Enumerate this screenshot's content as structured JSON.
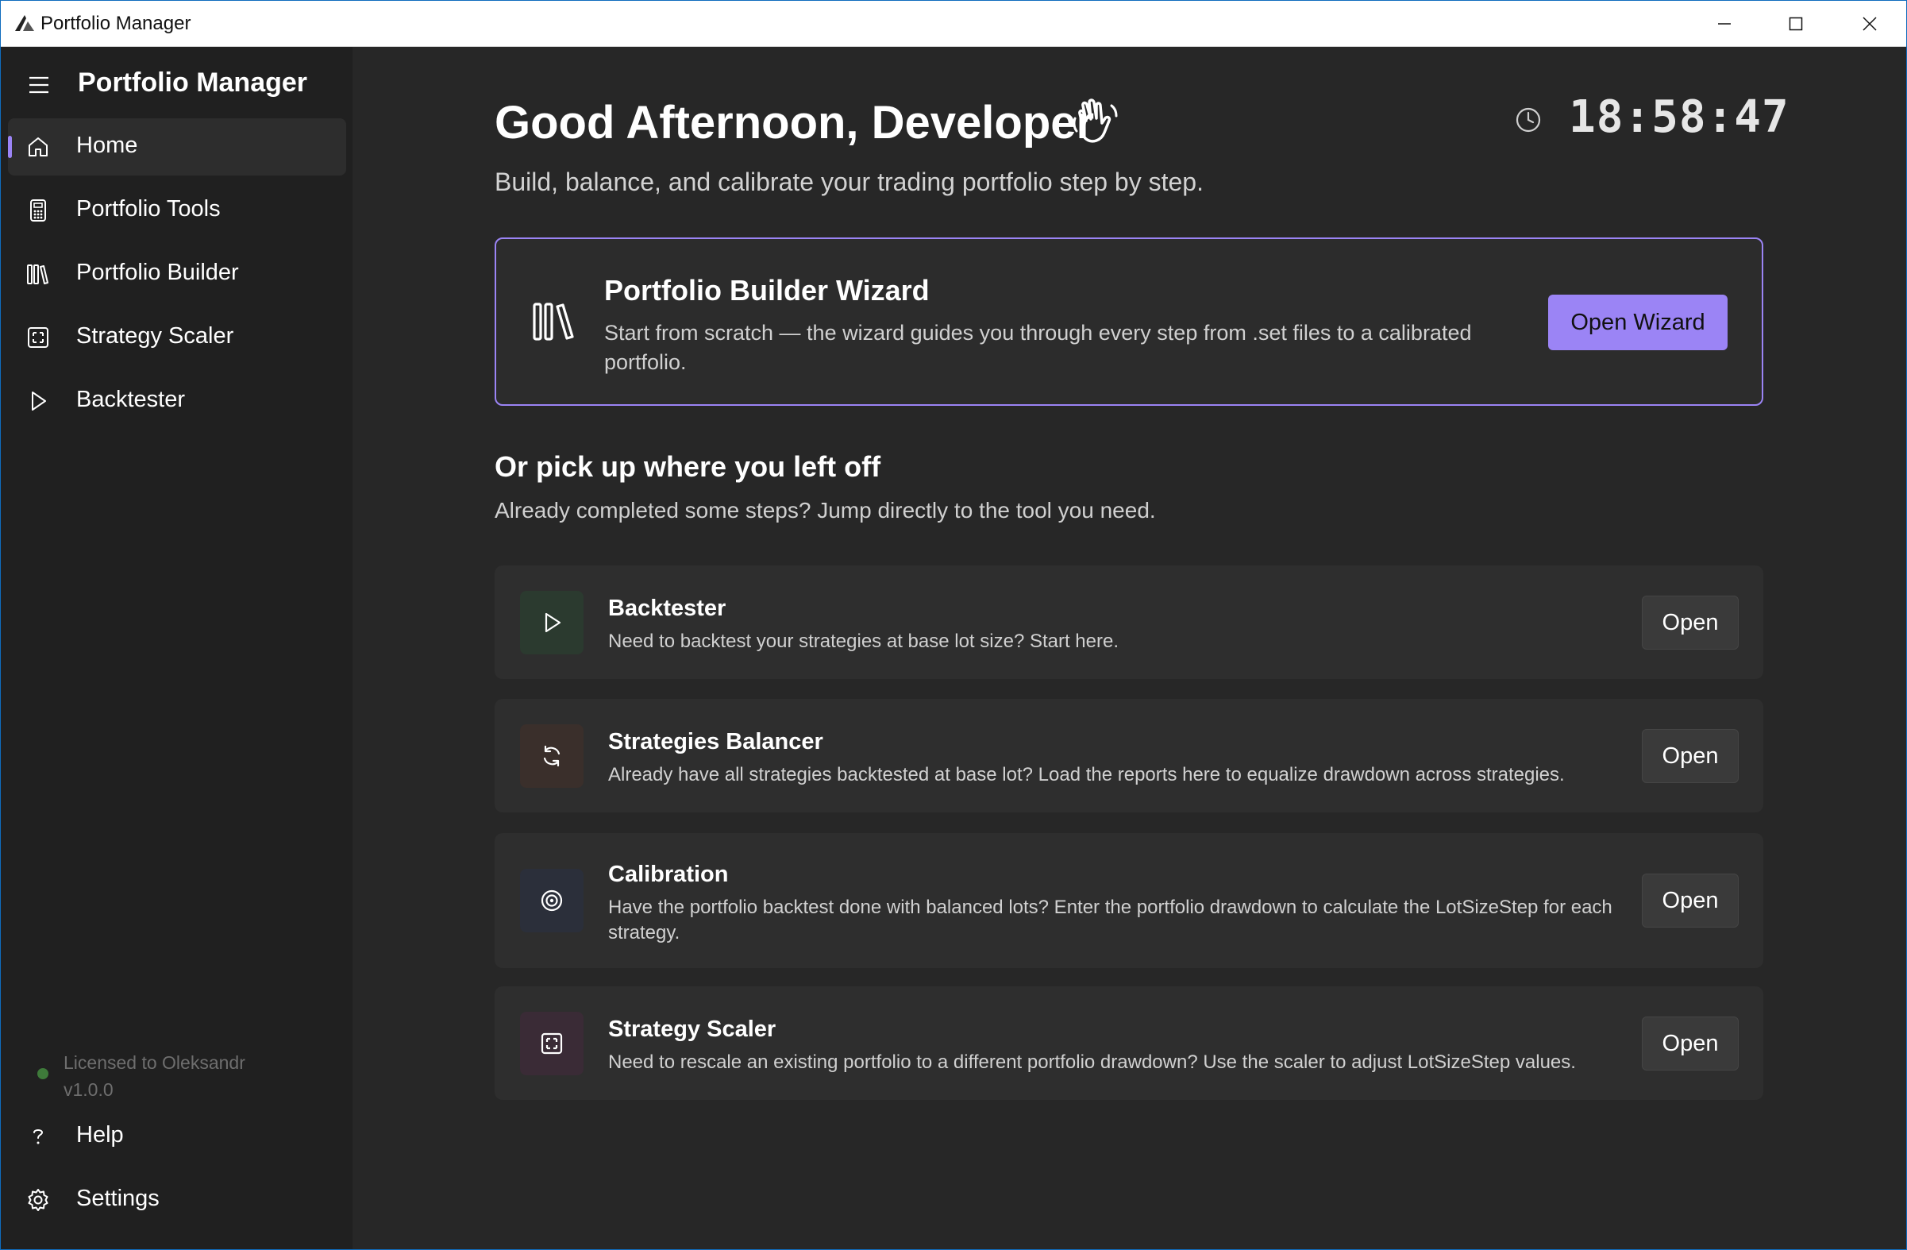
{
  "window": {
    "title": "Portfolio Manager"
  },
  "sidebar": {
    "title": "Portfolio Manager",
    "items": [
      {
        "label": "Home",
        "icon": "home-icon",
        "selected": true
      },
      {
        "label": "Portfolio Tools",
        "icon": "calculator-icon",
        "selected": false
      },
      {
        "label": "Portfolio Builder",
        "icon": "library-icon",
        "selected": false
      },
      {
        "label": "Strategy Scaler",
        "icon": "scale-grid-icon",
        "selected": false
      },
      {
        "label": "Backtester",
        "icon": "play-icon",
        "selected": false
      }
    ],
    "license": {
      "text": "Licensed to Oleksandr",
      "version": "v1.0.0"
    },
    "footer_items": [
      {
        "label": "Help",
        "icon": "question-icon"
      },
      {
        "label": "Settings",
        "icon": "gear-icon"
      }
    ]
  },
  "header": {
    "greeting": "Good Afternoon, Developer",
    "greeting_icon": "waving-hand-icon",
    "subtitle": "Build, balance, and calibrate your trading portfolio step by step.",
    "clock": "18:58:47"
  },
  "wizard": {
    "title": "Portfolio Builder Wizard",
    "description": "Start from scratch — the wizard guides you through every step from .set files to a calibrated portfolio.",
    "button": "Open Wizard"
  },
  "resume": {
    "title": "Or pick up where you left off",
    "subtitle": "Already completed some steps? Jump directly to the tool you need.",
    "tools": [
      {
        "title": "Backtester",
        "description": "Need to backtest your strategies at base lot size? Start here.",
        "button": "Open",
        "icon": "play-icon"
      },
      {
        "title": "Strategies Balancer",
        "description": "Already have all strategies backtested at base lot? Load the reports here to equalize drawdown across strategies.",
        "button": "Open",
        "icon": "refresh-icon"
      },
      {
        "title": "Calibration",
        "description": "Have the portfolio backtest done with balanced lots? Enter the portfolio drawdown to calculate the LotSizeStep for each strategy.",
        "button": "Open",
        "icon": "target-icon"
      },
      {
        "title": "Strategy Scaler",
        "description": "Need to rescale an existing portfolio to a different portfolio drawdown? Use the scaler to adjust LotSizeStep values.",
        "button": "Open",
        "icon": "scale-grid-icon"
      }
    ]
  },
  "colors": {
    "accent": "#9b84f5",
    "background": "#272727",
    "sidebar": "#202020",
    "card": "#2e2e2e"
  }
}
